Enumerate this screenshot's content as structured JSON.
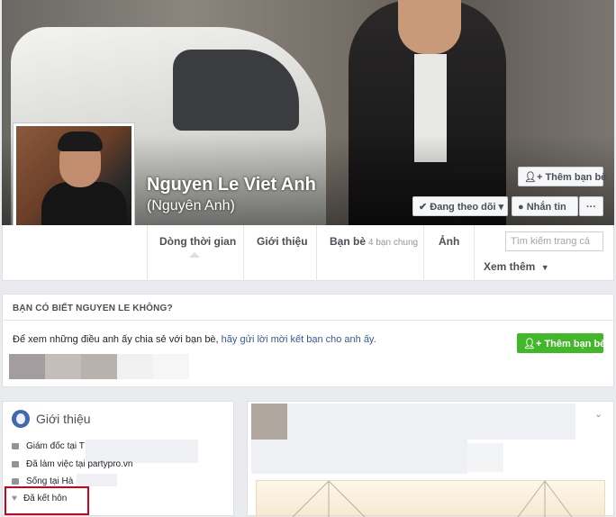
{
  "profile": {
    "name": "Nguyen Le Viet Anh",
    "alternate_name": "(Nguyên Anh)"
  },
  "header_buttons": {
    "add_friend": "Thêm bạn bè",
    "following": "Đang theo dõi",
    "message": "Nhắn tin",
    "more": "···"
  },
  "nav": {
    "timeline": "Dòng thời gian",
    "about": "Giới thiệu",
    "friends": "Bạn bè",
    "friends_count": "4 bạn chung",
    "photos": "Ảnh",
    "more": "Xem thêm",
    "search_placeholder": "Tìm kiếm trang cá"
  },
  "suggest": {
    "title": "BẠN CÓ BIẾT NGUYEN LE KHÔNG?",
    "text": "Để xem những điều anh ấy chia sẻ với bạn bè, ",
    "link": "hãy gửi lời mời kết bạn cho anh ấy.",
    "button": "Thêm bạn bè"
  },
  "intro": {
    "title": "Giới thiệu",
    "items": [
      "Giám đốc tại T",
      "Đã làm việc tại partypro.vn",
      "Sống tại Hà",
      "Đã kết hôn"
    ]
  },
  "colors": {
    "accent": "#365899",
    "green": "#42b72a",
    "highlight": "#d0021b"
  }
}
